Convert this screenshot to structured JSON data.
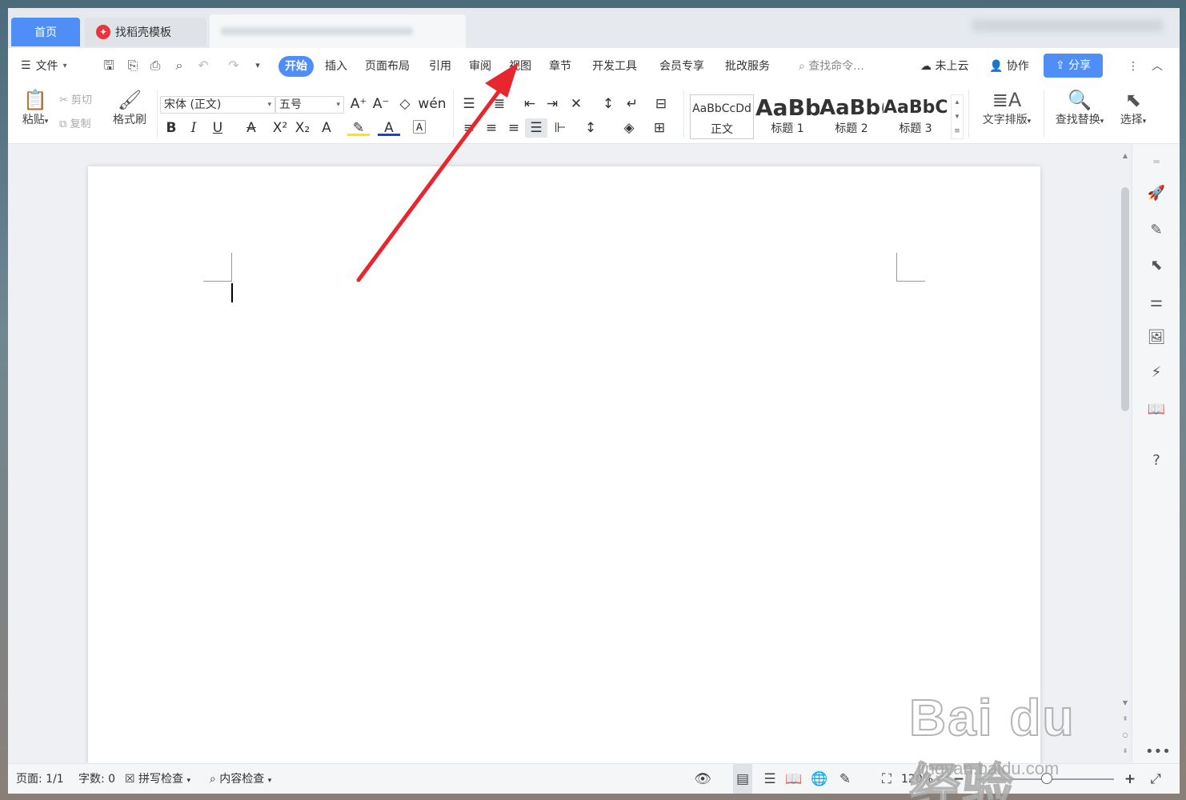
{
  "tabs": {
    "home": "首页",
    "template": "找稻壳模板"
  },
  "menu": {
    "file": "文件",
    "tabs": [
      "开始",
      "插入",
      "页面布局",
      "引用",
      "审阅",
      "视图",
      "章节",
      "开发工具",
      "会员专享",
      "批改服务"
    ],
    "search_placeholder": "查找命令...",
    "cloud": "未上云",
    "collab": "协作",
    "share": "分享"
  },
  "ribbon": {
    "paste": "粘贴",
    "cut": "剪切",
    "copy": "复制",
    "format_painter": "格式刷",
    "font_name": "宋体 (正文)",
    "font_size": "五号",
    "styles": [
      {
        "preview": "AaBbCcDd",
        "name": "正文"
      },
      {
        "preview": "AaBb",
        "name": "标题 1"
      },
      {
        "preview": "AaBb(",
        "name": "标题 2"
      },
      {
        "preview": "AaBbC(",
        "name": "标题 3"
      }
    ],
    "text_layout": "文字排版",
    "find_replace": "查找替换",
    "select": "选择"
  },
  "status": {
    "page": "页面: 1/1",
    "words": "字数: 0",
    "spell_check": "拼写检查",
    "content_check": "内容检查",
    "zoom": "120%",
    "zoom_level": 0.51
  },
  "watermark": {
    "brand": "Bai du 经验",
    "url": "jingyan.baidu.com"
  },
  "colors": {
    "accent": "#4f8ef7",
    "annotation": "#e8262d"
  }
}
